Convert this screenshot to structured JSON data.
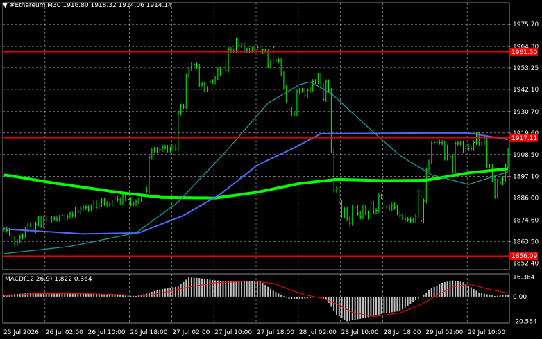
{
  "header": {
    "symbol": "#Ethereum,M30",
    "open": "1916.80",
    "high": "1918.32",
    "low": "1914.06",
    "close": "1914.14"
  },
  "colors": {
    "background": "#000000",
    "candle": "#00ff00",
    "grid": "#ffffff",
    "ma_green": "#00ff00",
    "ma_blue": "#4a6cf0",
    "ma_teal": "#1b8f8f",
    "level_line": "#ff0000",
    "level_label_bg": "#ff0000",
    "macd_hist": "#c0c0c0",
    "macd_signal": "#ff0000",
    "axis_text": "#ffffff"
  },
  "icons": {
    "header_arrow": "dropdown-triangle-icon"
  },
  "chart_data": {
    "type": "candlestick",
    "timeframe": "M30",
    "price_axis": {
      "ticks": [
        "1975.70",
        "1964.30",
        "1953.25",
        "1942.10",
        "1930.70",
        "1919.60",
        "1908.50",
        "1897.10",
        "1886.00",
        "1874.60",
        "1863.50",
        "1852.40"
      ],
      "ylim": [
        1849.0,
        1984.0
      ]
    },
    "levels": [
      {
        "value": 1961.5,
        "label": "1961.50"
      },
      {
        "value": 1917.11,
        "label": "1917.11"
      },
      {
        "value": 1856.09,
        "label": "1856.09"
      }
    ],
    "time_axis": {
      "labels": [
        "25 Jul 2026",
        "26 Jul 02:00",
        "26 Jul 10:00",
        "26 Jul 18:00",
        "27 Jul 02:00",
        "27 Jul 10:00",
        "27 Jul 18:00",
        "28 Jul 02:00",
        "28 Jul 10:00",
        "28 Jul 18:00",
        "29 Jul 02:00",
        "29 Jul 10:00"
      ]
    },
    "bars_count": 192,
    "closes": [
      1870.0,
      1869.3,
      1867.5,
      1865.2,
      1862.2,
      1863.7,
      1865.8,
      1866.6,
      1869.8,
      1871.9,
      1872.4,
      1869.1,
      1872.6,
      1875.5,
      1871.7,
      1875.9,
      1874.7,
      1874.6,
      1875.6,
      1875.3,
      1875.0,
      1876.1,
      1877.0,
      1875.7,
      1876.5,
      1877.7,
      1877.2,
      1880.3,
      1878.8,
      1880.7,
      1881.2,
      1881.0,
      1880.1,
      1881.7,
      1883.8,
      1881.2,
      1882.5,
      1884.9,
      1883.2,
      1882.7,
      1882.9,
      1884.0,
      1885.9,
      1885.2,
      1883.8,
      1887.0,
      1885.5,
      1885.3,
      1883.0,
      1883.1,
      1884.2,
      1885.1,
      1886.6,
      1890.7,
      1889.5,
      1906.9,
      1910.7,
      1911.2,
      1910.2,
      1911.1,
      1912.3,
      1912.3,
      1910.8,
      1911.4,
      1912.5,
      1911.4,
      1929.9,
      1933.5,
      1933.2,
      1949.0,
      1952.9,
      1955.0,
      1954.7,
      1953.9,
      1944.6,
      1944.9,
      1942.1,
      1942.6,
      1946.2,
      1946.1,
      1948.1,
      1952.5,
      1950.1,
      1956.1,
      1952.0,
      1962.7,
      1962.1,
      1962.0,
      1967.5,
      1964.9,
      1965.1,
      1961.9,
      1962.5,
      1962.0,
      1962.9,
      1963.2,
      1963.8,
      1961.6,
      1962.1,
      1961.9,
      1954.3,
      1956.3,
      1963.8,
      1956.8,
      1957.1,
      1950.4,
      1943.4,
      1936.3,
      1931.8,
      1929.4,
      1929.3,
      1941.1,
      1941.7,
      1941.7,
      1939.0,
      1941.6,
      1942.2,
      1946.2,
      1946.1,
      1949.2,
      1944.2,
      1936.9,
      1946.1,
      1941.6,
      1910.7,
      1890.0,
      1891.1,
      1883.9,
      1876.8,
      1880.3,
      1875.3,
      1872.9,
      1881.4,
      1881.3,
      1878.3,
      1876.2,
      1881.5,
      1878.4,
      1876.2,
      1883.4,
      1878.7,
      1879.6,
      1887.0,
      1886.7,
      1881.4,
      1881.7,
      1880.4,
      1882.4,
      1881.1,
      1878.4,
      1877.0,
      1875.9,
      1875.0,
      1874.9,
      1874.3,
      1874.5,
      1876.6,
      1889.7,
      1874.1,
      1884.5,
      1900.6,
      1904.6,
      1914.4,
      1914.7,
      1914.9,
      1914.7,
      1914.5,
      1906.6,
      1912.4,
      1907.5,
      1900.1,
      1914.3,
      1914.5,
      1914.5,
      1910.3,
      1913.1,
      1911.4,
      1911.5,
      1914.7,
      1918.7,
      1914.3,
      1914.0,
      1917.2,
      1902.6,
      1902.6,
      1895.5,
      1886.8,
      1894.8,
      1893.8,
      1895.8,
      1902.8,
      1910.6,
      1915.7,
      1914.1
    ],
    "moving_averages": [
      {
        "color": "ma_green",
        "points": [
          [
            0,
            1898.0
          ],
          [
            20,
            1893.5
          ],
          [
            45,
            1888.6
          ],
          [
            60,
            1886.3
          ],
          [
            80,
            1886.0
          ],
          [
            96,
            1889.0
          ],
          [
            112,
            1893.5
          ],
          [
            126,
            1895.6
          ],
          [
            144,
            1895.0
          ],
          [
            160,
            1895.2
          ],
          [
            176,
            1899.0
          ],
          [
            192,
            1901.3
          ]
        ]
      },
      {
        "color": "ma_blue",
        "points": [
          [
            0,
            1870.0
          ],
          [
            30,
            1867.5
          ],
          [
            51,
            1868.0
          ],
          [
            68,
            1877.0
          ],
          [
            82,
            1888.0
          ],
          [
            96,
            1903.0
          ],
          [
            110,
            1912.0
          ],
          [
            120,
            1919.2
          ],
          [
            160,
            1919.6
          ],
          [
            176,
            1919.6
          ],
          [
            192,
            1916.0
          ]
        ]
      },
      {
        "color": "ma_teal",
        "points": [
          [
            0,
            1857.3
          ],
          [
            25,
            1861.0
          ],
          [
            50,
            1868.0
          ],
          [
            66,
            1884.0
          ],
          [
            84,
            1910.0
          ],
          [
            100,
            1935.0
          ],
          [
            112,
            1944.6
          ],
          [
            116,
            1946.0
          ],
          [
            124,
            1940.0
          ],
          [
            140,
            1920.0
          ],
          [
            150,
            1908.0
          ],
          [
            162,
            1898.0
          ],
          [
            176,
            1893.0
          ],
          [
            192,
            1900.0
          ]
        ]
      }
    ],
    "macd": {
      "label": "MACD(12,26,9)",
      "main": "1.822",
      "signal": "0.364",
      "ticks": [
        "16.384",
        "0.00",
        "-20.564"
      ],
      "ylim": [
        -22.0,
        19.0
      ],
      "hist_points": [
        [
          0,
          1.5
        ],
        [
          10,
          3.0
        ],
        [
          20,
          2.8
        ],
        [
          30,
          2.5
        ],
        [
          40,
          1.5
        ],
        [
          50,
          0.5
        ],
        [
          54,
          2.5
        ],
        [
          58,
          5.5
        ],
        [
          66,
          8.5
        ],
        [
          70,
          16.0
        ],
        [
          74,
          15.5
        ],
        [
          80,
          13.5
        ],
        [
          90,
          12.8
        ],
        [
          97,
          13.0
        ],
        [
          102,
          5.0
        ],
        [
          108,
          -2.0
        ],
        [
          114,
          -1.5
        ],
        [
          118,
          -0.5
        ],
        [
          122,
          -2.0
        ],
        [
          126,
          -15.0
        ],
        [
          130,
          -20.5
        ],
        [
          136,
          -18.0
        ],
        [
          144,
          -14.0
        ],
        [
          150,
          -12.0
        ],
        [
          154,
          -6.0
        ],
        [
          158,
          0.0
        ],
        [
          162,
          7.0
        ],
        [
          166,
          11.5
        ],
        [
          170,
          13.5
        ],
        [
          174,
          12.0
        ],
        [
          180,
          3.5
        ],
        [
          186,
          0.5
        ],
        [
          192,
          2.0
        ]
      ],
      "signal_points": [
        [
          0,
          0.8
        ],
        [
          12,
          2.5
        ],
        [
          30,
          2.6
        ],
        [
          48,
          1.4
        ],
        [
          54,
          1.0
        ],
        [
          62,
          4.0
        ],
        [
          70,
          8.0
        ],
        [
          80,
          11.5
        ],
        [
          94,
          13.0
        ],
        [
          102,
          11.0
        ],
        [
          108,
          6.0
        ],
        [
          114,
          1.5
        ],
        [
          120,
          -1.0
        ],
        [
          126,
          -6.0
        ],
        [
          132,
          -13.0
        ],
        [
          140,
          -16.5
        ],
        [
          150,
          -13.5
        ],
        [
          158,
          -6.5
        ],
        [
          164,
          1.0
        ],
        [
          170,
          8.0
        ],
        [
          176,
          10.5
        ],
        [
          184,
          6.0
        ],
        [
          192,
          2.5
        ]
      ]
    }
  }
}
